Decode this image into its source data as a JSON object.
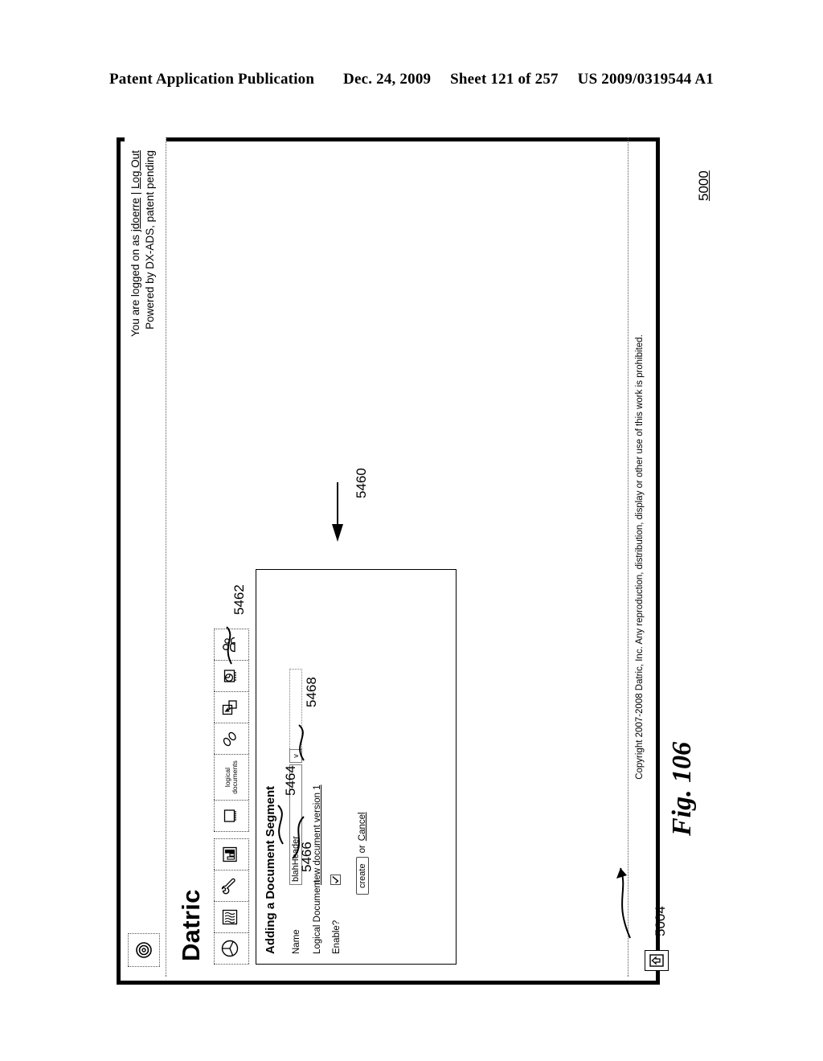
{
  "patent_header": {
    "left": "Patent Application Publication",
    "date": "Dec. 24, 2009",
    "sheet": "Sheet 121 of 257",
    "number": "US 2009/0319544 A1"
  },
  "figure": {
    "label": "Fig. 106"
  },
  "app": {
    "brand": "Datric",
    "status": {
      "line1_prefix": "You are logged on as ",
      "line1_user": "jdoerre",
      "line1_sep": " | ",
      "line1_logout": "Log Out",
      "line2": "Powered by DX-ADS, patent pending",
      "logo_icon": "circle-logo-icon"
    },
    "toolbar": {
      "items": [
        {
          "icon": "pie-chart-icon",
          "label": ""
        },
        {
          "icon": "fabric-swatch-icon",
          "label": ""
        },
        {
          "icon": "wrench-icon",
          "label": ""
        },
        {
          "icon": "bar-chart-icon",
          "label": ""
        },
        {
          "icon": "chip-icon",
          "label": ""
        },
        {
          "icon": "text-icon",
          "label": "logical documents"
        },
        {
          "icon": "links-icon",
          "label": ""
        },
        {
          "icon": "cursor-select-icon",
          "label": ""
        },
        {
          "icon": "chip-pie-icon",
          "label": ""
        },
        {
          "icon": "people-icon",
          "label": ""
        }
      ]
    },
    "dialog": {
      "title": "Adding a Document Segment",
      "fields": {
        "name_label": "Name",
        "name_value": "blahHeader",
        "name_dropdown_caret": "v",
        "logical_label": "Logical Document",
        "logical_value": "new document version 1",
        "enable_label": "Enable?",
        "enable_checked": true
      },
      "actions": {
        "create_label": "create",
        "or_label": "or",
        "cancel_label": "Cancel"
      }
    },
    "footer": {
      "copyright": "Copyright 2007-2008 Datric, Inc. Any reproduction, distribution, display or other use of this work is prohibited.",
      "icon": "upload-house-icon"
    }
  },
  "reference_numerals": {
    "window": "5000",
    "footer_bar": "5004",
    "dialog": "5460",
    "name_dropdown": "5462",
    "enable_checkbox": "5464",
    "create_button": "5466",
    "cancel_link": "5468"
  }
}
